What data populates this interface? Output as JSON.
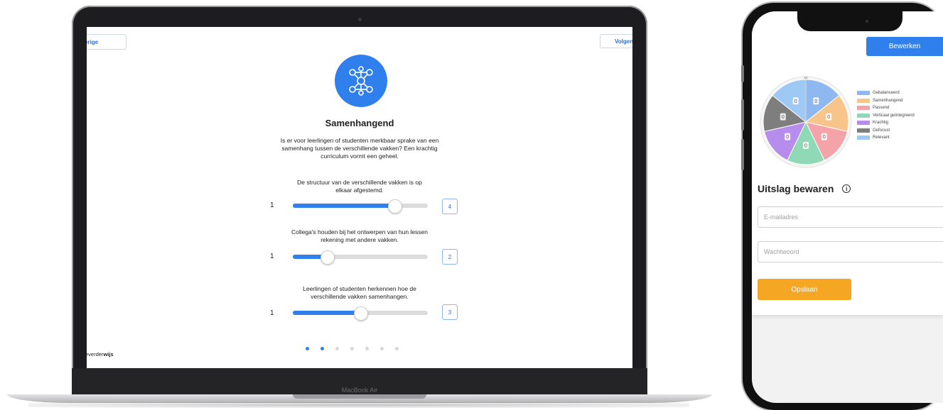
{
  "laptop": {
    "model_label": "MacBook Air",
    "nav": {
      "prev_label": "erige",
      "next_label": "Volgen"
    },
    "icon": "network-nodes-icon",
    "title": "Samenhangend",
    "description": "Is er voor leerlingen of studenten merkbaar sprake van een samenhang tussen de verschillende vakken? Een krachtig curriculum vormt een geheel.",
    "questions": [
      {
        "text": "De structuur van de verschillende vakken is op elkaar afgestemd.",
        "min": "1",
        "value": "4",
        "fraction": 0.75
      },
      {
        "text": "Collega's houden bij het ontwerpen van hun lessen rekening met andere vakken.",
        "min": "1",
        "value": "2",
        "fraction": 0.25
      },
      {
        "text": "Leerlingen of studenten herkennen hoe de verschillende vakken samenhangen.",
        "min": "1",
        "value": "3",
        "fraction": 0.5
      }
    ],
    "pagination": {
      "total": 7,
      "active": [
        0,
        1
      ]
    },
    "brand": {
      "prefix": "everder",
      "suffix": "wijs"
    }
  },
  "phone": {
    "edit_label": "Bewerken",
    "chart_data": {
      "type": "pie",
      "categories": [
        "Gebalanceerd",
        "Samenhangend",
        "Passend",
        "Verticaal geïntegreerd",
        "Krachtig",
        "Gefocust",
        "Relevant"
      ],
      "values": [
        1,
        1,
        1,
        1,
        1,
        1,
        1
      ],
      "slice_labels": [
        "0",
        "0",
        "0",
        "0",
        "0",
        "0",
        "0"
      ],
      "colors": [
        "#8fb8f0",
        "#f7c58a",
        "#f4a3a8",
        "#8fd9b6",
        "#b68cec",
        "#7e7e7e",
        "#9ec9f5"
      ],
      "rlim": [
        0,
        10
      ],
      "scale_max_label": "10",
      "legend_position": "right"
    },
    "save_title": "Uitslag bewaren",
    "info_icon": "info-icon",
    "email_placeholder": "E-mailadres",
    "password_placeholder": "Wachtwoord",
    "save_label": "Opslaan"
  }
}
